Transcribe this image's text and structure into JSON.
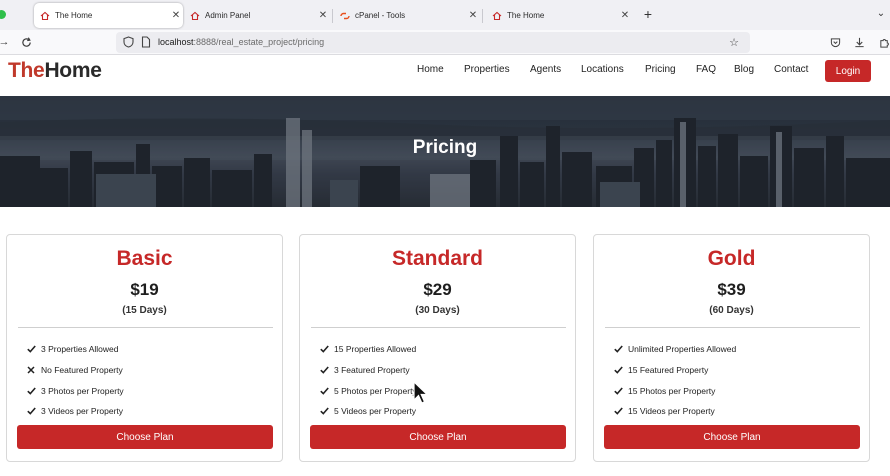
{
  "browser": {
    "tabs": [
      {
        "title": "The Home",
        "active": true
      },
      {
        "title": "Admin Panel",
        "active": false
      },
      {
        "title": "cPanel - Tools",
        "active": false
      },
      {
        "title": "The Home",
        "active": false
      }
    ],
    "url_host": "localhost",
    "url_rest": ":8888/real_estate_project/pricing"
  },
  "site": {
    "logo_part1": "The",
    "logo_part2": "Home",
    "menu": [
      "Home",
      "Properties",
      "Agents",
      "Locations",
      "Pricing",
      "FAQ",
      "Blog",
      "Contact"
    ],
    "login_label": "Login"
  },
  "hero": {
    "title": "Pricing"
  },
  "plans": [
    {
      "name": "Basic",
      "price": "$19",
      "duration": "(15 Days)",
      "features": [
        {
          "text": "3 Properties Allowed",
          "included": true
        },
        {
          "text": "No Featured Property",
          "included": false
        },
        {
          "text": "3 Photos per Property",
          "included": true
        },
        {
          "text": "3 Videos per Property",
          "included": true
        }
      ],
      "button": "Choose Plan"
    },
    {
      "name": "Standard",
      "price": "$29",
      "duration": "(30 Days)",
      "features": [
        {
          "text": "15 Properties Allowed",
          "included": true
        },
        {
          "text": "3 Featured Property",
          "included": true
        },
        {
          "text": "5 Photos per Property",
          "included": true
        },
        {
          "text": "5 Videos per Property",
          "included": true
        }
      ],
      "button": "Choose Plan"
    },
    {
      "name": "Gold",
      "price": "$39",
      "duration": "(60 Days)",
      "features": [
        {
          "text": "Unlimited Properties Allowed",
          "included": true
        },
        {
          "text": "15 Featured Property",
          "included": true
        },
        {
          "text": "15 Photos per Property",
          "included": true
        },
        {
          "text": "15 Videos per Property",
          "included": true
        }
      ],
      "button": "Choose Plan"
    }
  ],
  "colors": {
    "accent": "#c62828",
    "text": "#222222",
    "chrome": "#f0f0f4"
  },
  "icons": {
    "check": "check-icon",
    "cross": "cross-icon"
  }
}
